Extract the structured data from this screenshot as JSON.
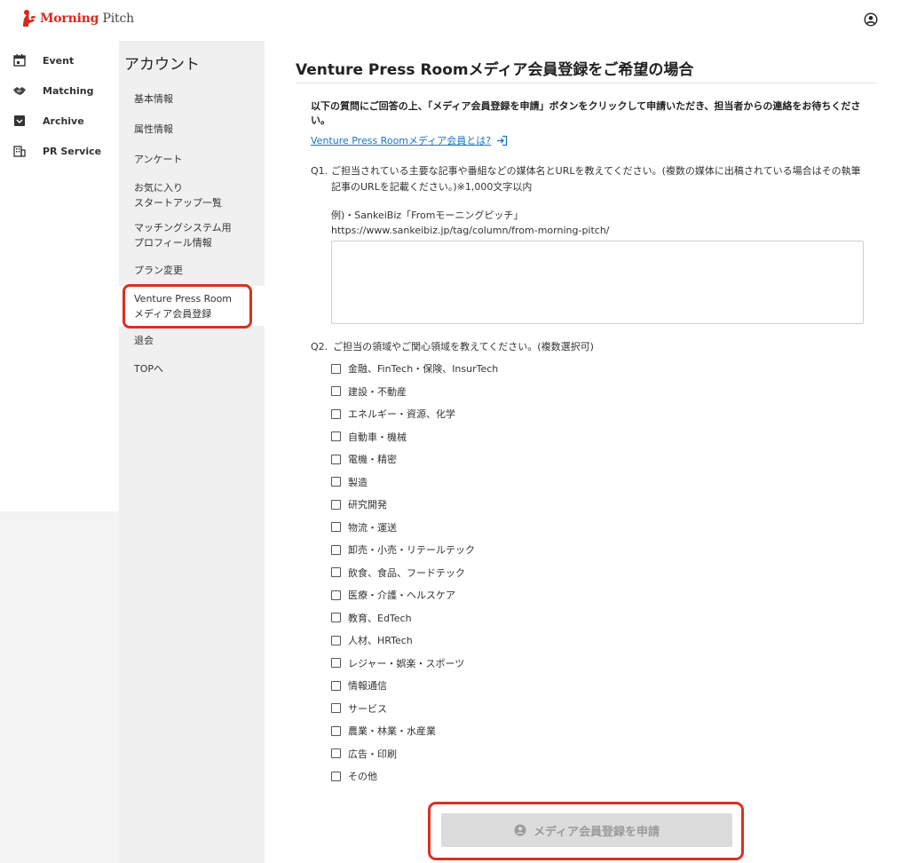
{
  "brand": {
    "word1": "Morning",
    "word2": "Pitch",
    "color": "#d52b1e"
  },
  "nav": [
    {
      "label": "Event",
      "icon": "calendar-icon"
    },
    {
      "label": "Matching",
      "icon": "handshake-icon"
    },
    {
      "label": "Archive",
      "icon": "archive-box-icon"
    },
    {
      "label": "PR Service",
      "icon": "building-icon"
    }
  ],
  "account": {
    "title": "アカウント",
    "items": [
      "基本情報",
      "属性情報",
      "アンケート",
      "お気に入り\nスタートアップ一覧",
      "マッチングシステム用\nプロフィール情報",
      "プラン変更",
      "Venture Press Room\nメディア会員登録",
      "退会",
      "TOPへ"
    ],
    "active_index": 6
  },
  "main": {
    "title": "Venture Press Roomメディア会員登録をご希望の場合",
    "intro": "以下の質問にご回答の上、「メディア会員登録を申請」ボタンをクリックして申請いただき、担当者からの連絡をお待ちください。",
    "info_link": "Venture Press Roomメディア会員とは?",
    "q1": {
      "number": "Q1.",
      "text": "ご担当されている主要な記事や番組などの媒体名とURLを教えてください。(複数の媒体に出稿されている場合はその執筆記事のURLを記載ください。)※1,000文字以内",
      "example_line1": "例)・SankeiBiz「Fromモーニングピッチ」",
      "example_line2": "https://www.sankeibiz.jp/tag/column/from-morning-pitch/",
      "answer": ""
    },
    "q2": {
      "number": "Q2.",
      "text": "ご担当の領域やご関心領域を教えてください。(複数選択可)",
      "options": [
        "金融、FinTech・保険、InsurTech",
        "建設・不動産",
        "エネルギー・資源、化学",
        "自動車・機械",
        "電機・精密",
        "製造",
        "研究開発",
        "物流・運送",
        "卸売・小売・リテールテック",
        "飲食、食品、フードテック",
        "医療・介護・ヘルスケア",
        "教育、EdTech",
        "人材、HRTech",
        "レジャー・娯楽・スポーツ",
        "情報通信",
        "サービス",
        "農業・林業・水産業",
        "広告・印刷",
        "その他"
      ]
    },
    "submit_label": "メディア会員登録を申請"
  },
  "colors": {
    "highlight": "#d93022",
    "link": "#1a73c8",
    "disabled_button": "#dcdcdc"
  }
}
